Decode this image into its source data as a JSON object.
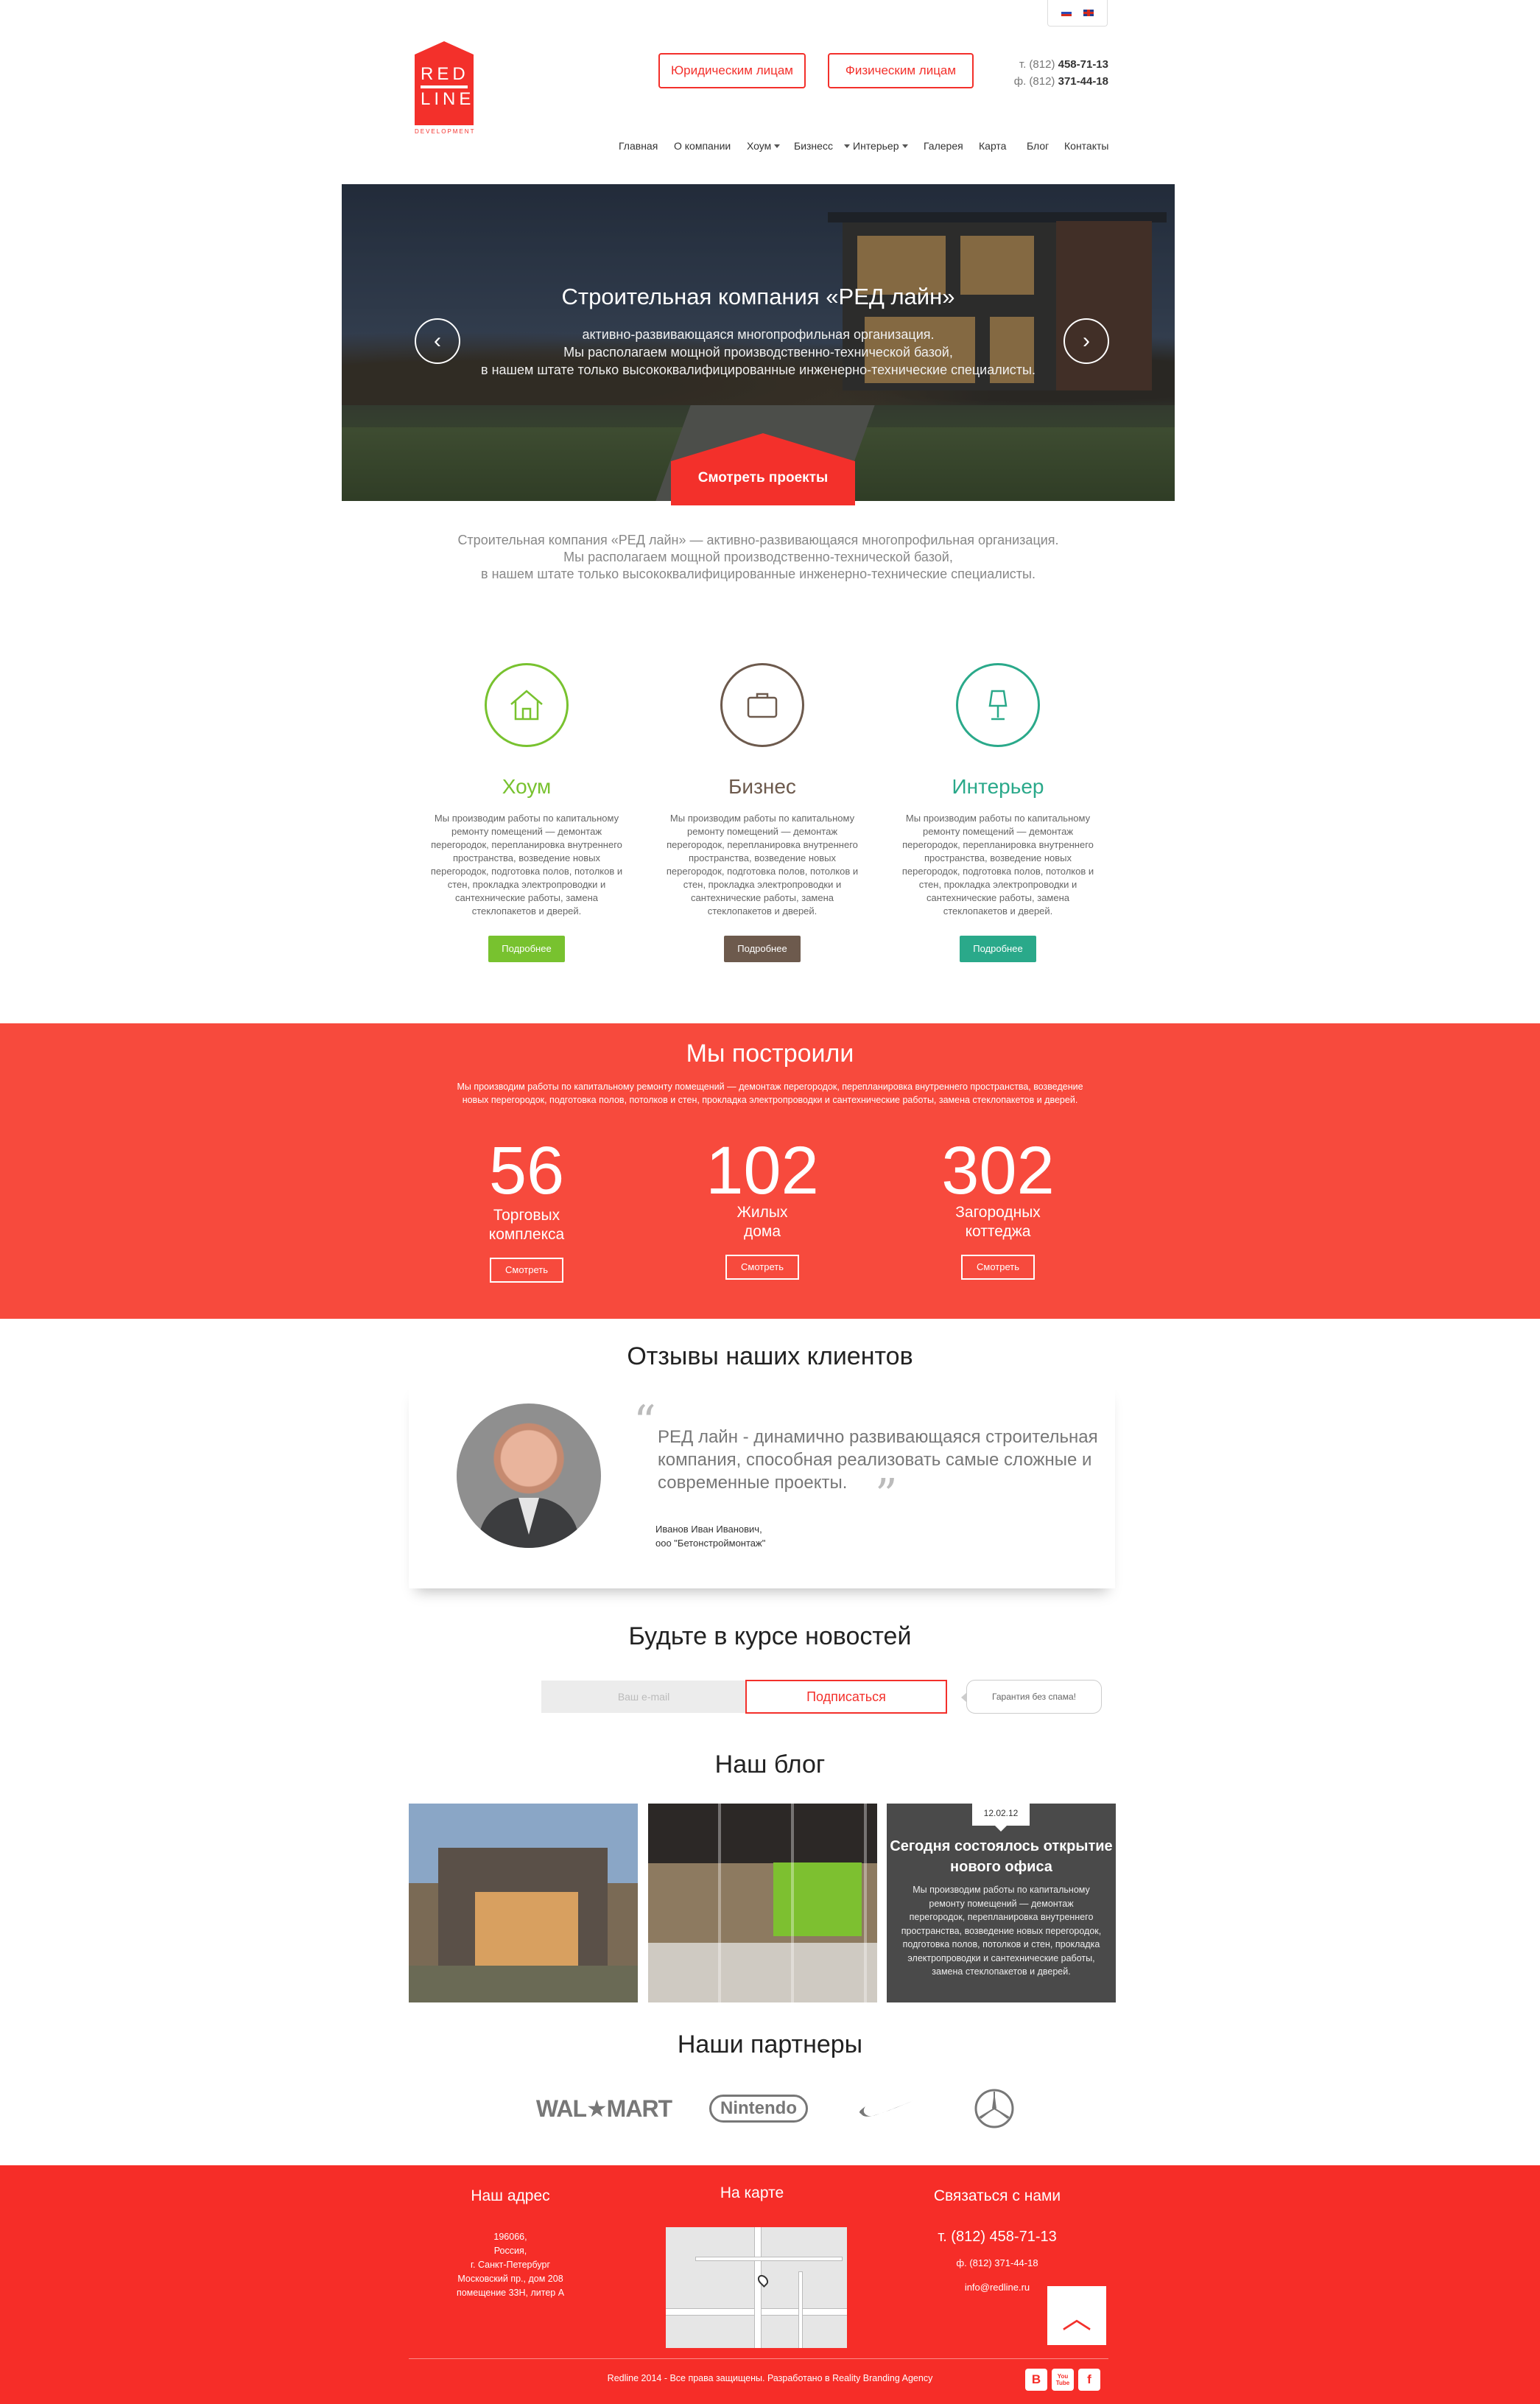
{
  "header": {
    "languages": [
      "ru",
      "en"
    ],
    "logo": {
      "line1": "RED",
      "line2": "LINE",
      "tagline": "DEVELOPMENT"
    },
    "buttons": {
      "legal": "Юридическим лицам",
      "personal": "Физическим лицам"
    },
    "phone_prefix": "т. (812)",
    "phone": "458-71-13",
    "fax_prefix": "ф. (812)",
    "fax": "371-44-18",
    "nav": [
      "Главная",
      "О компании",
      "Хоум",
      "Бизнесс",
      "Интерьер",
      "Галерея",
      "Карта",
      "Блог",
      "Контакты"
    ]
  },
  "hero": {
    "title": "Строительная компания «РЕД лайн»",
    "line1": "активно-развивающаяся многопрофильная организация.",
    "line2": "Мы располагаем мощной производственно-технической базой,",
    "line3": "в нашем штате только высококвалифицированные инженерно-технические специалисты.",
    "cta": "Смотреть проекты"
  },
  "intro": {
    "line1": "Строительная компания «РЕД лайн» — активно-развивающаяся многопрофильная организация.",
    "line2": "Мы располагаем мощной производственно-технической базой,",
    "line3": "в нашем штате только высококвалифицированные инженерно-технические специалисты."
  },
  "services": [
    {
      "title": "Хоум",
      "icon": "house-icon",
      "color": "#78c22f",
      "more": "Подробнее",
      "text": "Мы производим работы по капитальному ремонту помещений — демонтаж перегородок, перепланировка внутреннего пространства, возведение новых перегородок, подготовка полов, потолков и стен, прокладка электропроводки и сантехнические работы, замена стеклопакетов и дверей."
    },
    {
      "title": "Бизнес",
      "icon": "briefcase-icon",
      "color": "#6d5a4d",
      "more": "Подробнее",
      "text": "Мы производим работы по капитальному ремонту помещений — демонтаж перегородок, перепланировка внутреннего пространства, возведение новых перегородок, подготовка полов, потолков и стен, прокладка электропроводки и сантехнические работы, замена стеклопакетов и дверей."
    },
    {
      "title": "Интерьер",
      "icon": "lamp-icon",
      "color": "#2aa98a",
      "more": "Подробнее",
      "text": "Мы производим работы по капитальному ремонту помещений — демонтаж перегородок, перепланировка внутреннего пространства, возведение новых перегородок, подготовка полов, потолков и стен, прокладка электропроводки и сантехнические работы, замена стеклопакетов и дверей."
    }
  ],
  "built": {
    "title": "Мы построили",
    "text": "Мы производим работы по капитальному ремонту помещений — демонтаж перегородок, перепланировка внутреннего пространства, возведение новых перегородок, подготовка полов, потолков и стен, прокладка электропроводки и сантехнические работы, замена стеклопакетов и дверей.",
    "stats": [
      {
        "num": "56",
        "l1": "Торговых",
        "l2": "комплекса",
        "btn": "Смотреть"
      },
      {
        "num": "102",
        "l1": "Жилых",
        "l2": "дома",
        "btn": "Смотреть"
      },
      {
        "num": "302",
        "l1": "Загородных",
        "l2": "коттеджа",
        "btn": "Смотреть"
      }
    ]
  },
  "reviews": {
    "title": "Отзывы наших клиентов",
    "quote": "РЕД лайн - динамично развивающаяся строительная компания, способная реализовать самые сложные и современные проекты.",
    "author": "Иванов Иван Иванович,",
    "company": "ооо \"Бетонстроймонтаж\""
  },
  "subscribe": {
    "title": "Будьте в курсе новостей",
    "placeholder": "Ваш e-mail",
    "button": "Подписаться",
    "guarantee": "Гарантия без спама!"
  },
  "blog": {
    "title": "Наш блог",
    "date": "12.02.12",
    "post_title": "Сегодня состоялось открытие нового офиса",
    "post_text": "Мы производим работы по капитальному ремонту помещений — демонтаж перегородок, перепланировка внутреннего пространства, возведение новых перегородок, подготовка полов, потолков и стен, прокладка электропроводки и сантехнические работы, замена стеклопакетов и дверей."
  },
  "partners": {
    "title": "Наши партнеры",
    "walmart": "WAL★MART",
    "nintendo": "Nintendo"
  },
  "footer": {
    "address_title": "Наш адрес",
    "address": [
      "196066,",
      "Россия,",
      "г. Санкт-Петербург",
      "Московский пр., дом 208",
      "помещение 33Н, литер А"
    ],
    "map_title": "На карте",
    "contact_title": "Связаться с нами",
    "phone": "т. (812) 458-71-13",
    "fax": "ф. (812) 371-44-18",
    "email": "info@redline.ru",
    "copyright": "Redline 2014 - Все права защищены. Разработано в Reality Branding Agency",
    "social": [
      "В",
      "You Tube",
      "f"
    ]
  },
  "colors": {
    "brand_red": "#f3302b",
    "home_green": "#78c22f",
    "business_brown": "#6d5a4d",
    "interior_teal": "#2aa98a"
  }
}
